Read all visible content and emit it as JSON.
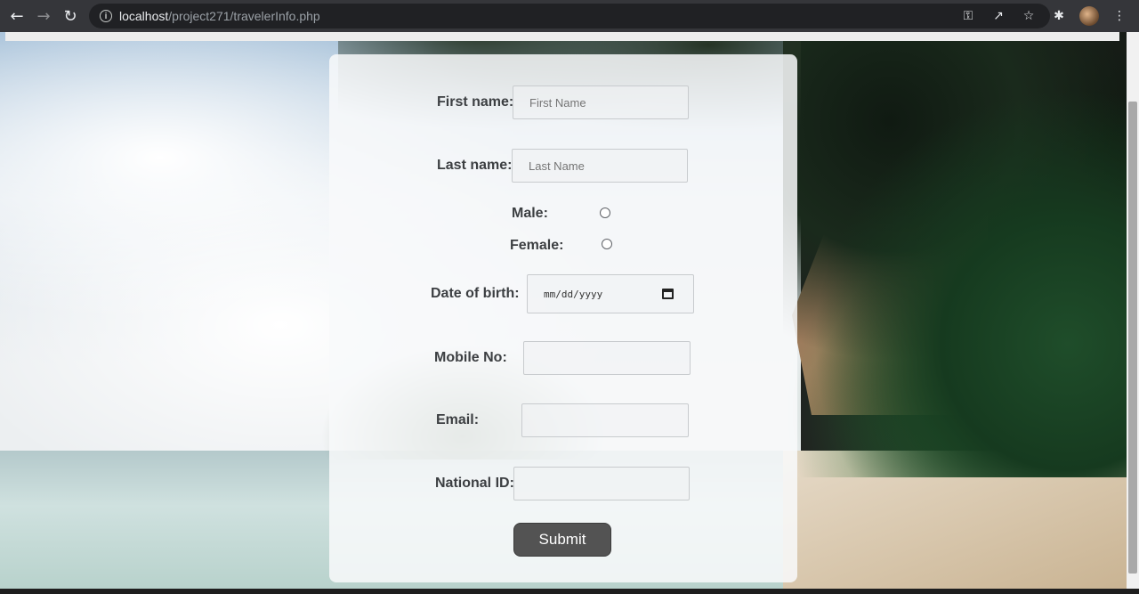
{
  "browser": {
    "url_host": "localhost",
    "url_path": "/project271/travelerInfo.php",
    "back_icon": "arrow-left-icon",
    "forward_icon": "arrow-right-icon",
    "reload_icon": "reload-icon",
    "icons": [
      "key-icon",
      "share-icon",
      "star-icon",
      "extensions-icon",
      "avatar",
      "menu-icon"
    ]
  },
  "form": {
    "first_name": {
      "label": "First name:",
      "placeholder": "First Name"
    },
    "last_name": {
      "label": "Last name:",
      "placeholder": "Last Name"
    },
    "gender": {
      "male_label": "Male:",
      "female_label": "Female:"
    },
    "dob": {
      "label": "Date of birth:",
      "placeholder": "mm/dd/yyyy"
    },
    "mobile": {
      "label": "Mobile No:"
    },
    "email": {
      "label": "Email:"
    },
    "national_id": {
      "label": "National ID:"
    },
    "submit_label": "Submit"
  }
}
